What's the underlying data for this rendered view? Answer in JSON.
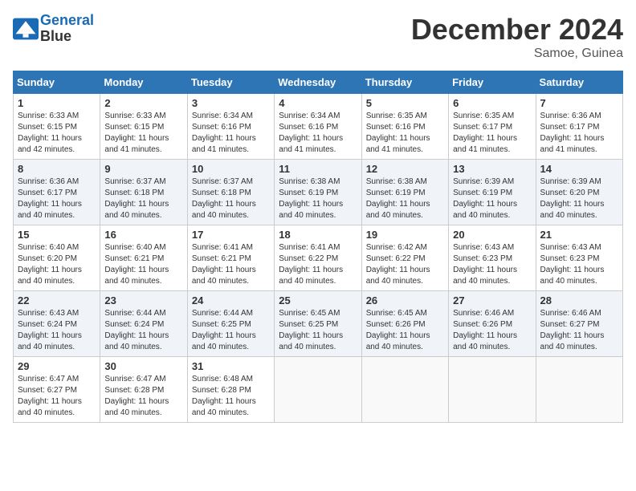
{
  "header": {
    "logo_line1": "General",
    "logo_line2": "Blue",
    "month": "December 2024",
    "location": "Samoe, Guinea"
  },
  "days_of_week": [
    "Sunday",
    "Monday",
    "Tuesday",
    "Wednesday",
    "Thursday",
    "Friday",
    "Saturday"
  ],
  "weeks": [
    [
      {
        "day": "1",
        "sunrise": "6:33 AM",
        "sunset": "6:15 PM",
        "daylight": "11 hours and 42 minutes."
      },
      {
        "day": "2",
        "sunrise": "6:33 AM",
        "sunset": "6:15 PM",
        "daylight": "11 hours and 41 minutes."
      },
      {
        "day": "3",
        "sunrise": "6:34 AM",
        "sunset": "6:16 PM",
        "daylight": "11 hours and 41 minutes."
      },
      {
        "day": "4",
        "sunrise": "6:34 AM",
        "sunset": "6:16 PM",
        "daylight": "11 hours and 41 minutes."
      },
      {
        "day": "5",
        "sunrise": "6:35 AM",
        "sunset": "6:16 PM",
        "daylight": "11 hours and 41 minutes."
      },
      {
        "day": "6",
        "sunrise": "6:35 AM",
        "sunset": "6:17 PM",
        "daylight": "11 hours and 41 minutes."
      },
      {
        "day": "7",
        "sunrise": "6:36 AM",
        "sunset": "6:17 PM",
        "daylight": "11 hours and 41 minutes."
      }
    ],
    [
      {
        "day": "8",
        "sunrise": "6:36 AM",
        "sunset": "6:17 PM",
        "daylight": "11 hours and 40 minutes."
      },
      {
        "day": "9",
        "sunrise": "6:37 AM",
        "sunset": "6:18 PM",
        "daylight": "11 hours and 40 minutes."
      },
      {
        "day": "10",
        "sunrise": "6:37 AM",
        "sunset": "6:18 PM",
        "daylight": "11 hours and 40 minutes."
      },
      {
        "day": "11",
        "sunrise": "6:38 AM",
        "sunset": "6:19 PM",
        "daylight": "11 hours and 40 minutes."
      },
      {
        "day": "12",
        "sunrise": "6:38 AM",
        "sunset": "6:19 PM",
        "daylight": "11 hours and 40 minutes."
      },
      {
        "day": "13",
        "sunrise": "6:39 AM",
        "sunset": "6:19 PM",
        "daylight": "11 hours and 40 minutes."
      },
      {
        "day": "14",
        "sunrise": "6:39 AM",
        "sunset": "6:20 PM",
        "daylight": "11 hours and 40 minutes."
      }
    ],
    [
      {
        "day": "15",
        "sunrise": "6:40 AM",
        "sunset": "6:20 PM",
        "daylight": "11 hours and 40 minutes."
      },
      {
        "day": "16",
        "sunrise": "6:40 AM",
        "sunset": "6:21 PM",
        "daylight": "11 hours and 40 minutes."
      },
      {
        "day": "17",
        "sunrise": "6:41 AM",
        "sunset": "6:21 PM",
        "daylight": "11 hours and 40 minutes."
      },
      {
        "day": "18",
        "sunrise": "6:41 AM",
        "sunset": "6:22 PM",
        "daylight": "11 hours and 40 minutes."
      },
      {
        "day": "19",
        "sunrise": "6:42 AM",
        "sunset": "6:22 PM",
        "daylight": "11 hours and 40 minutes."
      },
      {
        "day": "20",
        "sunrise": "6:43 AM",
        "sunset": "6:23 PM",
        "daylight": "11 hours and 40 minutes."
      },
      {
        "day": "21",
        "sunrise": "6:43 AM",
        "sunset": "6:23 PM",
        "daylight": "11 hours and 40 minutes."
      }
    ],
    [
      {
        "day": "22",
        "sunrise": "6:43 AM",
        "sunset": "6:24 PM",
        "daylight": "11 hours and 40 minutes."
      },
      {
        "day": "23",
        "sunrise": "6:44 AM",
        "sunset": "6:24 PM",
        "daylight": "11 hours and 40 minutes."
      },
      {
        "day": "24",
        "sunrise": "6:44 AM",
        "sunset": "6:25 PM",
        "daylight": "11 hours and 40 minutes."
      },
      {
        "day": "25",
        "sunrise": "6:45 AM",
        "sunset": "6:25 PM",
        "daylight": "11 hours and 40 minutes."
      },
      {
        "day": "26",
        "sunrise": "6:45 AM",
        "sunset": "6:26 PM",
        "daylight": "11 hours and 40 minutes."
      },
      {
        "day": "27",
        "sunrise": "6:46 AM",
        "sunset": "6:26 PM",
        "daylight": "11 hours and 40 minutes."
      },
      {
        "day": "28",
        "sunrise": "6:46 AM",
        "sunset": "6:27 PM",
        "daylight": "11 hours and 40 minutes."
      }
    ],
    [
      {
        "day": "29",
        "sunrise": "6:47 AM",
        "sunset": "6:27 PM",
        "daylight": "11 hours and 40 minutes."
      },
      {
        "day": "30",
        "sunrise": "6:47 AM",
        "sunset": "6:28 PM",
        "daylight": "11 hours and 40 minutes."
      },
      {
        "day": "31",
        "sunrise": "6:48 AM",
        "sunset": "6:28 PM",
        "daylight": "11 hours and 40 minutes."
      },
      null,
      null,
      null,
      null
    ]
  ],
  "labels": {
    "sunrise": "Sunrise:",
    "sunset": "Sunset:",
    "daylight": "Daylight:"
  }
}
